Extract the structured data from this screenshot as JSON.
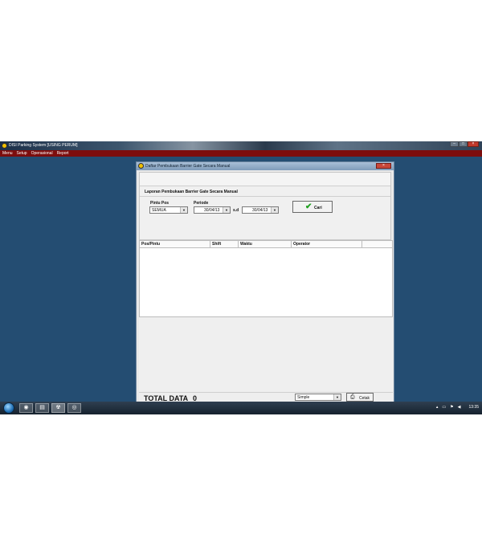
{
  "window": {
    "title": "DISI Parking System [USING PERUM]",
    "controls": {
      "minimize": "–",
      "maximize": "□",
      "close": "×"
    }
  },
  "menu": [
    "Menu",
    "Setup",
    "Operasional",
    "Report"
  ],
  "dialog": {
    "title": "Daftar Pembukaan Barrier Gate Secara Manual",
    "close_glyph": "×",
    "report_title": "Laporan Pembukaan Barrier Gate Secara Manual",
    "pintu_pos_label": "Pintu Pos",
    "pintu_pos_value": "SEMUA",
    "periode_label": "Periode",
    "date_from": "30/04/13",
    "sd_label": "s.d",
    "date_to": "30/04/13",
    "cari_label": "Cari",
    "columns": [
      "Pos/Pintu",
      "Shift",
      "Waktu",
      "Operator"
    ],
    "total_label": "TOTAL DATA",
    "total_value": "0",
    "mode_value": "Simple",
    "cetak_label": "Cetak"
  },
  "taskbar": {
    "clock": "13:35",
    "icons": [
      "start-orb-icon",
      "browser-icon",
      "explorer-icon",
      "app-icon",
      "media-icon"
    ]
  },
  "colors": {
    "desktop": "#244d72",
    "menubar": "#7d0d0d",
    "cari_check": "#1fa01f"
  }
}
